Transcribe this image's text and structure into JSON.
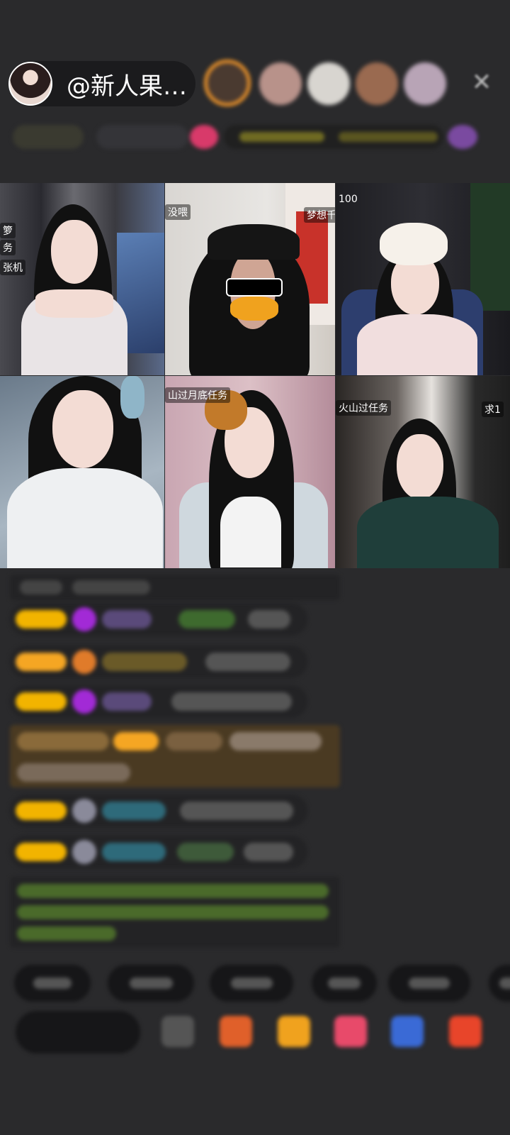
{
  "host": {
    "name": "@新人果…"
  },
  "grid": {
    "tiles": [
      {
        "labels": [
          "箩",
          "务",
          "张机"
        ]
      },
      {
        "labels": [
          "没喂",
          "梦想千"
        ]
      },
      {
        "labels": [
          "100"
        ]
      },
      {
        "labels": []
      },
      {
        "labels": [
          "山过月底任务"
        ]
      },
      {
        "labels": [
          "火山过任务",
          "求1"
        ]
      }
    ]
  },
  "colors": {
    "background": "#2a2a2c",
    "accent_orange": "#f5a623",
    "badge_gold": "#f2b400"
  }
}
